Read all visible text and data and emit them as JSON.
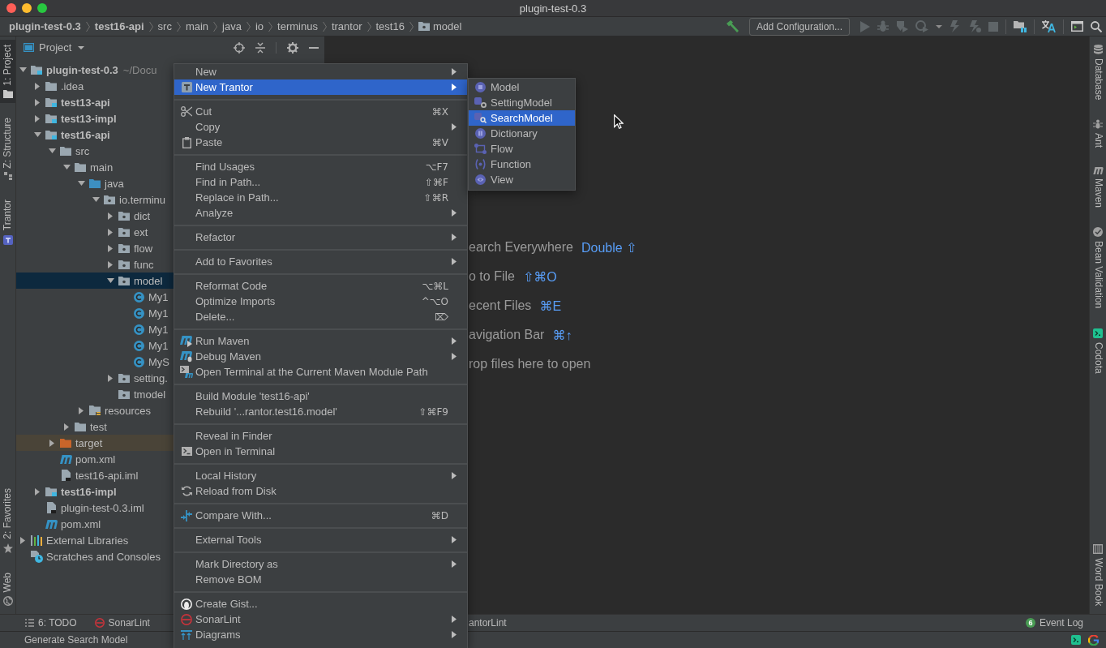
{
  "window": {
    "title": "plugin-test-0.3"
  },
  "breadcrumbs": [
    {
      "label": "plugin-test-0.3",
      "kind": "module"
    },
    {
      "label": "test16-api",
      "kind": "module"
    },
    {
      "label": "src",
      "kind": "folder"
    },
    {
      "label": "main",
      "kind": "folder"
    },
    {
      "label": "java",
      "kind": "folder"
    },
    {
      "label": "io",
      "kind": "folder"
    },
    {
      "label": "terminus",
      "kind": "folder"
    },
    {
      "label": "trantor",
      "kind": "folder"
    },
    {
      "label": "test16",
      "kind": "folder"
    },
    {
      "label": "model",
      "kind": "package"
    }
  ],
  "toolbar": {
    "run_configuration": "Add Configuration..."
  },
  "left_stripe": {
    "top_tabs": [
      {
        "label": "1: Project",
        "selected": true
      },
      {
        "label": "Z: Structure",
        "selected": false
      },
      {
        "label": "Trantor",
        "selected": false
      }
    ],
    "bottom_tabs": [
      {
        "label": "2: Favorites",
        "selected": false
      },
      {
        "label": "Web",
        "selected": false
      }
    ]
  },
  "project_panel": {
    "title": "Project",
    "tree": [
      {
        "label": "plugin-test-0.3",
        "path": "~/Docu",
        "kind": "module",
        "expanded": true,
        "selected": false,
        "children": [
          {
            "label": ".idea",
            "kind": "folder",
            "expanded": false,
            "selected": false
          },
          {
            "label": "test13-api",
            "kind": "module",
            "expanded": false,
            "selected": false
          },
          {
            "label": "test13-impl",
            "kind": "module",
            "expanded": false,
            "selected": false
          },
          {
            "label": "test16-api",
            "kind": "module",
            "expanded": true,
            "selected": false,
            "children": [
              {
                "label": "src",
                "kind": "folder",
                "expanded": true,
                "selected": false,
                "children": [
                  {
                    "label": "main",
                    "kind": "folder",
                    "expanded": true,
                    "selected": false,
                    "children": [
                      {
                        "label": "java",
                        "kind": "source-root",
                        "expanded": true,
                        "selected": false,
                        "children": [
                          {
                            "label": "io.terminu",
                            "kind": "package",
                            "expanded": true,
                            "selected": false,
                            "children": [
                              {
                                "label": "dict",
                                "kind": "package",
                                "expanded": false,
                                "selected": false
                              },
                              {
                                "label": "ext",
                                "kind": "package",
                                "expanded": false,
                                "selected": false
                              },
                              {
                                "label": "flow",
                                "kind": "package",
                                "expanded": false,
                                "selected": false
                              },
                              {
                                "label": "func",
                                "kind": "package",
                                "expanded": false,
                                "selected": false
                              },
                              {
                                "label": "model",
                                "kind": "package",
                                "expanded": true,
                                "selected": true,
                                "children": [
                                  {
                                    "label": "My1",
                                    "kind": "class",
                                    "selected": false
                                  },
                                  {
                                    "label": "My1",
                                    "kind": "class",
                                    "selected": false
                                  },
                                  {
                                    "label": "My1",
                                    "kind": "class",
                                    "selected": false
                                  },
                                  {
                                    "label": "My1",
                                    "kind": "class",
                                    "selected": false
                                  },
                                  {
                                    "label": "MyS",
                                    "kind": "class",
                                    "selected": false
                                  }
                                ]
                              },
                              {
                                "label": "setting.",
                                "kind": "package",
                                "expanded": false,
                                "selected": false
                              },
                              {
                                "label": "tmodel",
                                "kind": "package",
                                "selected": false
                              }
                            ]
                          }
                        ]
                      },
                      {
                        "label": "resources",
                        "kind": "resources-root",
                        "expanded": false,
                        "selected": false
                      }
                    ]
                  },
                  {
                    "label": "test",
                    "kind": "folder",
                    "expanded": false,
                    "selected": false
                  }
                ]
              },
              {
                "label": "target",
                "kind": "excluded",
                "expanded": false,
                "selected": false
              },
              {
                "label": "pom.xml",
                "kind": "maven",
                "selected": false
              },
              {
                "label": "test16-api.iml",
                "kind": "iml",
                "selected": false
              }
            ]
          },
          {
            "label": "test16-impl",
            "kind": "module",
            "expanded": false,
            "selected": false
          },
          {
            "label": "plugin-test-0.3.iml",
            "kind": "iml",
            "selected": false
          },
          {
            "label": "pom.xml",
            "kind": "maven",
            "selected": false
          }
        ]
      },
      {
        "label": "External Libraries",
        "kind": "libraries",
        "expanded": false,
        "selected": false
      },
      {
        "label": "Scratches and Consoles",
        "kind": "scratches",
        "selected": false
      }
    ]
  },
  "editor": {
    "hints": [
      {
        "label": "earch Everywhere",
        "shortcut": "Double ⇧"
      },
      {
        "label": "o to File",
        "shortcut": "⇧⌘O"
      },
      {
        "label": "ecent Files",
        "shortcut": "⌘E"
      },
      {
        "label": "avigation Bar",
        "shortcut": "⌘↑"
      },
      {
        "label": "rop files here to open"
      }
    ]
  },
  "right_stripe": {
    "top_tabs": [
      {
        "label": "Database"
      },
      {
        "label": "Ant"
      },
      {
        "label": "Maven"
      },
      {
        "label": "Bean Validation"
      },
      {
        "label": "Codota"
      }
    ],
    "bottom_tabs": [
      {
        "label": "Word Book"
      }
    ]
  },
  "tool_window_bar": {
    "left_tabs": [
      {
        "label": "6: TODO"
      },
      {
        "label": "SonarLint"
      }
    ],
    "center_tabs": [
      {
        "label": "antorLint"
      }
    ],
    "right_tabs": [
      {
        "label": "Event Log",
        "badge": "6"
      }
    ]
  },
  "status_bar": {
    "message": "Generate Search Model"
  },
  "context_menu": {
    "groups": [
      {
        "items": [
          {
            "label": "New",
            "has_submenu": true,
            "selected": false
          },
          {
            "label": "New Trantor",
            "has_submenu": true,
            "selected": true
          }
        ]
      },
      {
        "items": [
          {
            "label": "Cut",
            "shortcut": "⌘X",
            "has_submenu": false,
            "selected": false
          },
          {
            "label": "Copy",
            "has_submenu": true,
            "selected": false
          },
          {
            "label": "Paste",
            "shortcut": "⌘V",
            "has_submenu": false,
            "selected": false
          }
        ]
      },
      {
        "items": [
          {
            "label": "Find Usages",
            "shortcut": "⌥F7",
            "has_submenu": false,
            "selected": false
          },
          {
            "label": "Find in Path...",
            "shortcut": "⇧⌘F",
            "has_submenu": false,
            "selected": false
          },
          {
            "label": "Replace in Path...",
            "shortcut": "⇧⌘R",
            "has_submenu": false,
            "selected": false
          },
          {
            "label": "Analyze",
            "has_submenu": true,
            "selected": false
          }
        ]
      },
      {
        "items": [
          {
            "label": "Refactor",
            "has_submenu": true,
            "selected": false
          }
        ]
      },
      {
        "items": [
          {
            "label": "Add to Favorites",
            "has_submenu": true,
            "selected": false
          }
        ]
      },
      {
        "items": [
          {
            "label": "Reformat Code",
            "shortcut": "⌥⌘L",
            "has_submenu": false,
            "selected": false
          },
          {
            "label": "Optimize Imports",
            "shortcut": "^⌥O",
            "has_submenu": false,
            "selected": false
          },
          {
            "label": "Delete...",
            "shortcut": "⌦",
            "has_submenu": false,
            "selected": false
          }
        ]
      },
      {
        "items": [
          {
            "label": "Run Maven",
            "has_submenu": true,
            "selected": false
          },
          {
            "label": "Debug Maven",
            "has_submenu": true,
            "selected": false
          },
          {
            "label": "Open Terminal at the Current Maven Module Path",
            "has_submenu": false,
            "selected": false
          }
        ]
      },
      {
        "items": [
          {
            "label": "Build Module 'test16-api'",
            "has_submenu": false,
            "selected": false
          },
          {
            "label": "Rebuild '...rantor.test16.model'",
            "shortcut": "⇧⌘F9",
            "has_submenu": false,
            "selected": false
          }
        ]
      },
      {
        "items": [
          {
            "label": "Reveal in Finder",
            "has_submenu": false,
            "selected": false
          },
          {
            "label": "Open in Terminal",
            "has_submenu": false,
            "selected": false
          }
        ]
      },
      {
        "items": [
          {
            "label": "Local History",
            "has_submenu": true,
            "selected": false
          },
          {
            "label": "Reload from Disk",
            "has_submenu": false,
            "selected": false
          }
        ]
      },
      {
        "items": [
          {
            "label": "Compare With...",
            "shortcut": "⌘D",
            "has_submenu": false,
            "selected": false
          }
        ]
      },
      {
        "items": [
          {
            "label": "External Tools",
            "has_submenu": true,
            "selected": false
          }
        ]
      },
      {
        "items": [
          {
            "label": "Mark Directory as",
            "has_submenu": true,
            "selected": false
          },
          {
            "label": "Remove BOM",
            "has_submenu": false,
            "selected": false
          }
        ]
      },
      {
        "items": [
          {
            "label": "Create Gist...",
            "has_submenu": false,
            "selected": false
          },
          {
            "label": "SonarLint",
            "has_submenu": true,
            "selected": false
          },
          {
            "label": "Diagrams",
            "has_submenu": true,
            "selected": false
          }
        ]
      }
    ],
    "submenu": {
      "items": [
        {
          "label": "Model",
          "selected": false
        },
        {
          "label": "SettingModel",
          "selected": false
        },
        {
          "label": "SearchModel",
          "selected": true
        },
        {
          "label": "Dictionary",
          "selected": false
        },
        {
          "label": "Flow",
          "selected": false
        },
        {
          "label": "Function",
          "selected": false
        },
        {
          "label": "View",
          "selected": false
        }
      ]
    }
  }
}
